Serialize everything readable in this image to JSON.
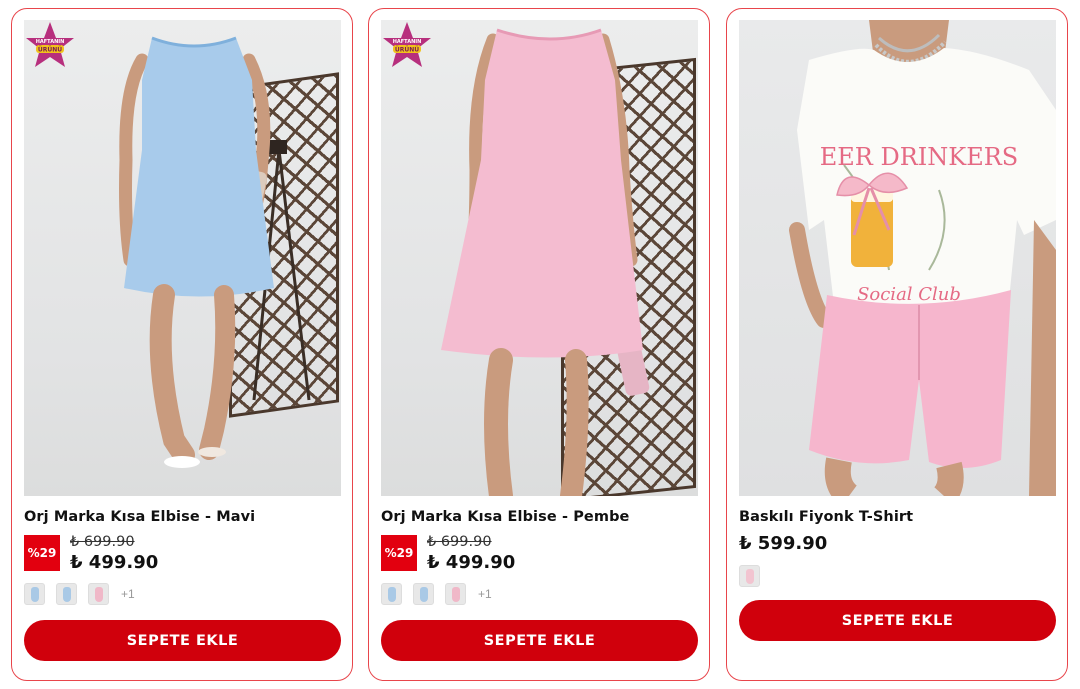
{
  "products": [
    {
      "name": "Orj Marka Kısa Elbise - Mavi",
      "badge": "HAFTANIN ÜRÜNÜ",
      "discount": "%29",
      "old_price": "₺ 699.90",
      "price": "₺ 499.90",
      "swatch_colors": [
        "#a9c9e6",
        "#a9c9e6",
        "#f0b8c8"
      ],
      "more": "+1",
      "button": "SEPETE EKLE",
      "dress_color": "#a8cbeb"
    },
    {
      "name": "Orj Marka Kısa Elbise - Pembe",
      "badge": "HAFTANIN ÜRÜNÜ",
      "discount": "%29",
      "old_price": "₺ 699.90",
      "price": "₺ 499.90",
      "swatch_colors": [
        "#a9c9e6",
        "#a9c9e6",
        "#f0b8c8"
      ],
      "more": "+1",
      "button": "SEPETE EKLE",
      "dress_color": "#f4bcd0"
    },
    {
      "name": "Baskılı Fiyonk T-Shirt",
      "price": "₺ 599.90",
      "swatch_colors": [
        "#f2c4d0"
      ],
      "button": "SEPETE EKLE",
      "tshirt_text": "EER DRINKERS",
      "tshirt_subtext": "Social Club"
    }
  ],
  "colors": {
    "accent": "#d0000c",
    "border": "#e8454b",
    "discount_bg": "#e2000f"
  }
}
